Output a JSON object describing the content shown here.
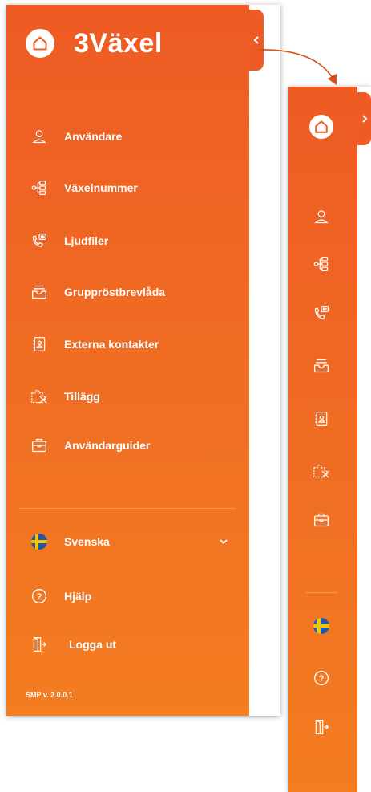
{
  "brand": {
    "name": "3Växel",
    "home_icon": "home-icon"
  },
  "nav": [
    {
      "key": "users",
      "label": "Användare",
      "icon": "user-icon"
    },
    {
      "key": "numbers",
      "label": "Växelnummer",
      "icon": "hierarchy-icon"
    },
    {
      "key": "audio",
      "label": "Ljudfiler",
      "icon": "phone-audio-icon"
    },
    {
      "key": "groupvoicemail",
      "label": "Gruppröstbrevlåda",
      "icon": "inbox-icon"
    },
    {
      "key": "contacts",
      "label": "Externa kontakter",
      "icon": "contact-book-icon"
    },
    {
      "key": "addons",
      "label": "Tillägg",
      "icon": "puzzle-icon"
    },
    {
      "key": "guides",
      "label": "Användarguider",
      "icon": "briefcase-icon"
    }
  ],
  "footer": {
    "language": {
      "label": "Svenska",
      "icon": "sweden-flag-icon"
    },
    "help": {
      "label": "Hjälp",
      "icon": "help-icon"
    },
    "logout": {
      "label": "Logga ut",
      "icon": "logout-icon"
    },
    "version": "SMP v. 2.0.0.1"
  },
  "colors": {
    "sidebar_top": "#ee5b24",
    "sidebar_bottom": "#f47d20",
    "text": "#ffffff",
    "flag_blue": "#1e5aa8",
    "flag_yellow": "#f7c400"
  }
}
